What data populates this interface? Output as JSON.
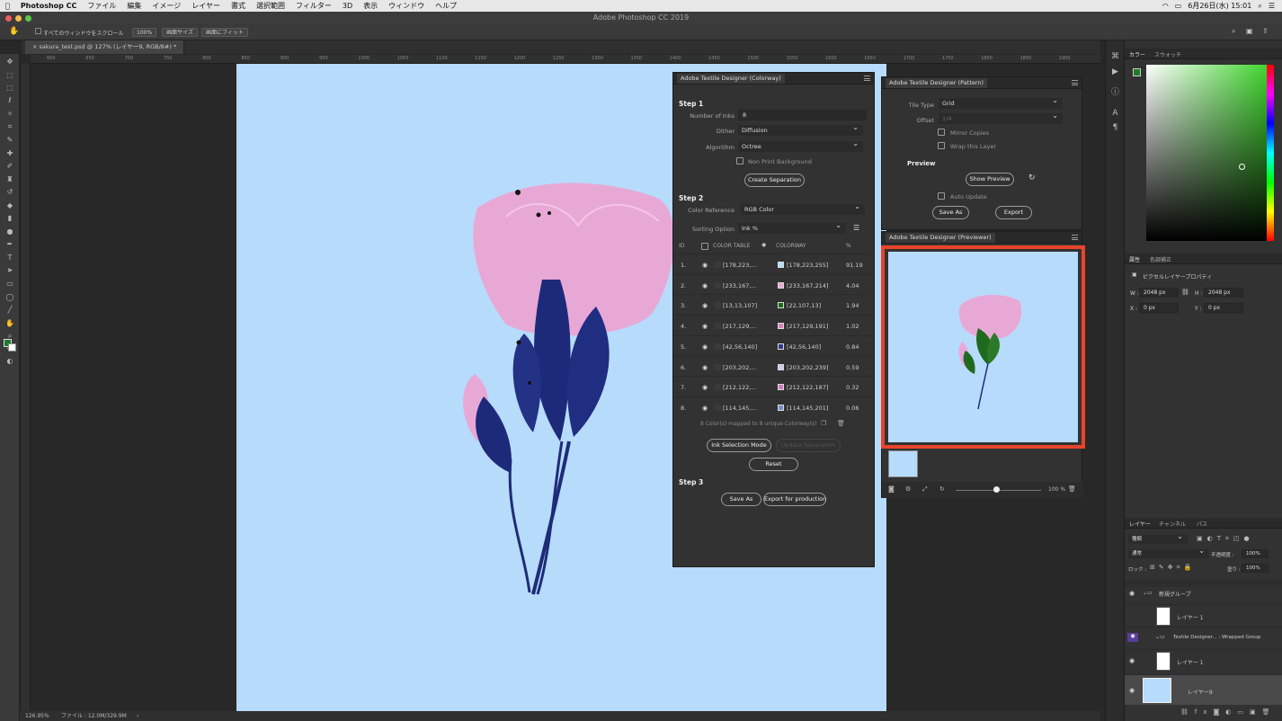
{
  "menubar": {
    "app": "Photoshop CC",
    "items": [
      "ファイル",
      "編集",
      "イメージ",
      "レイヤー",
      "書式",
      "選択範囲",
      "フィルター",
      "3D",
      "表示",
      "ウィンドウ",
      "ヘルプ"
    ],
    "clock": "6月26日(水) 15:01"
  },
  "window_title": "Adobe Photoshop CC 2019",
  "options": {
    "scroll_all": "すべてのウィンドウをスクロール",
    "zoom": "100%",
    "fit_screen": "画面サイズ",
    "fill_screen": "画面にフィット"
  },
  "doc_tab": "sakura_test.psd @ 127% (レイヤー9, RGB/8#) *",
  "ruler_ticks": [
    "600",
    "650",
    "700",
    "750",
    "800",
    "850",
    "900",
    "950",
    "1000",
    "1050",
    "1100",
    "1150",
    "1200",
    "1250",
    "1300",
    "1350",
    "1400",
    "1450",
    "1500",
    "1550",
    "1600",
    "1650",
    "1700",
    "1750",
    "1800",
    "1850",
    "1900"
  ],
  "status": {
    "zoom": "126.95%",
    "file": "ファイル : 12.0M/329.9M"
  },
  "colorway": {
    "title": "Adobe Textile Designer (Colorway)",
    "step1": "Step 1",
    "step2": "Step 2",
    "step3": "Step 3",
    "num_inks_label": "Number of Inks",
    "num_inks": "8",
    "dither_label": "Dither",
    "dither": "Diffusion",
    "algorithm_label": "Algorithm",
    "algorithm": "Octree",
    "non_print": "Non Print Background",
    "create_sep": "Create Separation",
    "color_ref_label": "Color Reference",
    "color_ref": "RGB Color",
    "sorting_label": "Sorting Option",
    "sorting": "Ink %",
    "headers": {
      "id": "ID",
      "table": "COLOR TABLE",
      "colorway": "COLORWAY",
      "pct": "%"
    },
    "rows": [
      {
        "id": "1.",
        "table": "[178,223,...",
        "colorway": "[178,223,255]",
        "pct": "91.19",
        "color": "#b2dfff"
      },
      {
        "id": "2.",
        "table": "[233,167,...",
        "colorway": "[233,167,214]",
        "pct": "4.04",
        "color": "#e9a7d6"
      },
      {
        "id": "3.",
        "table": "[13,13,107]",
        "colorway": "[22,107,13]",
        "pct": "1.94",
        "color": "#166b0d"
      },
      {
        "id": "4.",
        "table": "[217,129,...",
        "colorway": "[217,129,191]",
        "pct": "1.02",
        "color": "#d981bf"
      },
      {
        "id": "5.",
        "table": "[42,56,140]",
        "colorway": "[42,56,140]",
        "pct": "0.84",
        "color": "#2a388c"
      },
      {
        "id": "6.",
        "table": "[203,202,...",
        "colorway": "[203,202,239]",
        "pct": "0.59",
        "color": "#cbcaef"
      },
      {
        "id": "7.",
        "table": "[212,122,...",
        "colorway": "[212,122,187]",
        "pct": "0.32",
        "color": "#d47abb"
      },
      {
        "id": "8.",
        "table": "[114,145,...",
        "colorway": "[114,145,201]",
        "pct": "0.06",
        "color": "#7291c9"
      }
    ],
    "mapped": "8 Color(s) mapped to 8 unique Colorway(s)",
    "ink_mode": "Ink Selection Mode",
    "update_sep": "Update Separation",
    "reset": "Reset",
    "save_as": "Save As",
    "export_prod": "Export for production"
  },
  "pattern": {
    "title": "Adobe Textile Designer (Pattern)",
    "tile_type_label": "Tile Type",
    "tile_type": "Grid",
    "offset_label": "Offset",
    "offset": "1/4",
    "mirror": "Mirror Copies",
    "wrap": "Wrap this Layer",
    "preview": "Preview",
    "show_preview": "Show Preview",
    "auto_update": "Auto Update",
    "save_as": "Save As",
    "export": "Export"
  },
  "previewer": {
    "title": "Adobe Textile Designer (Previewer)",
    "zoom": "100 %"
  },
  "color_panel": {
    "tab1": "カラー",
    "tab2": "スウォッチ"
  },
  "props": {
    "tab1": "属性",
    "tab2": "色調補正",
    "kind": "ピクセルレイヤープロパティ",
    "w_label": "W :",
    "w": "2048 px",
    "h_label": "H :",
    "h": "2048 px",
    "x_label": "X :",
    "x": "0 px",
    "y_label": "Y :",
    "y": "0 px"
  },
  "layers": {
    "tab1": "レイヤー",
    "tab2": "チャンネル",
    "tab3": "パス",
    "kind": "種類",
    "mode": "通常",
    "opacity_label": "不透明度 :",
    "opacity": "100%",
    "lock_label": "ロック :",
    "fill_label": "塗り :",
    "fill": "100%",
    "items": [
      "新規グループ",
      "レイヤー 1",
      "Textile Designer... : Wrapped Group",
      "レイヤー 1",
      "レイヤー9"
    ]
  }
}
